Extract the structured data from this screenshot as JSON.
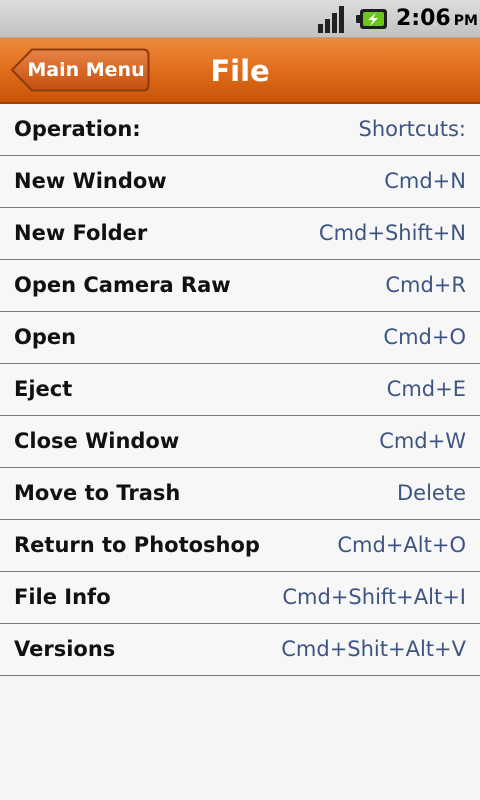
{
  "status_bar": {
    "time": "2:06",
    "ampm": "PM",
    "icons": [
      "signal-strength-icon",
      "battery-charging-icon"
    ]
  },
  "header": {
    "back_label": "Main Menu",
    "title": "File"
  },
  "table": {
    "header": {
      "operation": "Operation:",
      "shortcut": "Shortcuts:"
    },
    "rows": [
      {
        "operation": "New Window",
        "shortcut": "Cmd+N"
      },
      {
        "operation": "New Folder",
        "shortcut": "Cmd+Shift+N"
      },
      {
        "operation": "Open Camera Raw",
        "shortcut": "Cmd+R"
      },
      {
        "operation": "Open",
        "shortcut": "Cmd+O"
      },
      {
        "operation": "Eject",
        "shortcut": "Cmd+E"
      },
      {
        "operation": "Close Window",
        "shortcut": "Cmd+W"
      },
      {
        "operation": "Move to Trash",
        "shortcut": "Delete"
      },
      {
        "operation": "Return to Photoshop",
        "shortcut": "Cmd+Alt+O"
      },
      {
        "operation": "File Info",
        "shortcut": "Cmd+Shift+Alt+I"
      },
      {
        "operation": "Versions",
        "shortcut": "Cmd+Shit+Alt+V"
      }
    ]
  },
  "colors": {
    "header_orange": "#e06d1c",
    "shortcut_text": "#3d5580",
    "battery_green": "#6cc51a"
  }
}
